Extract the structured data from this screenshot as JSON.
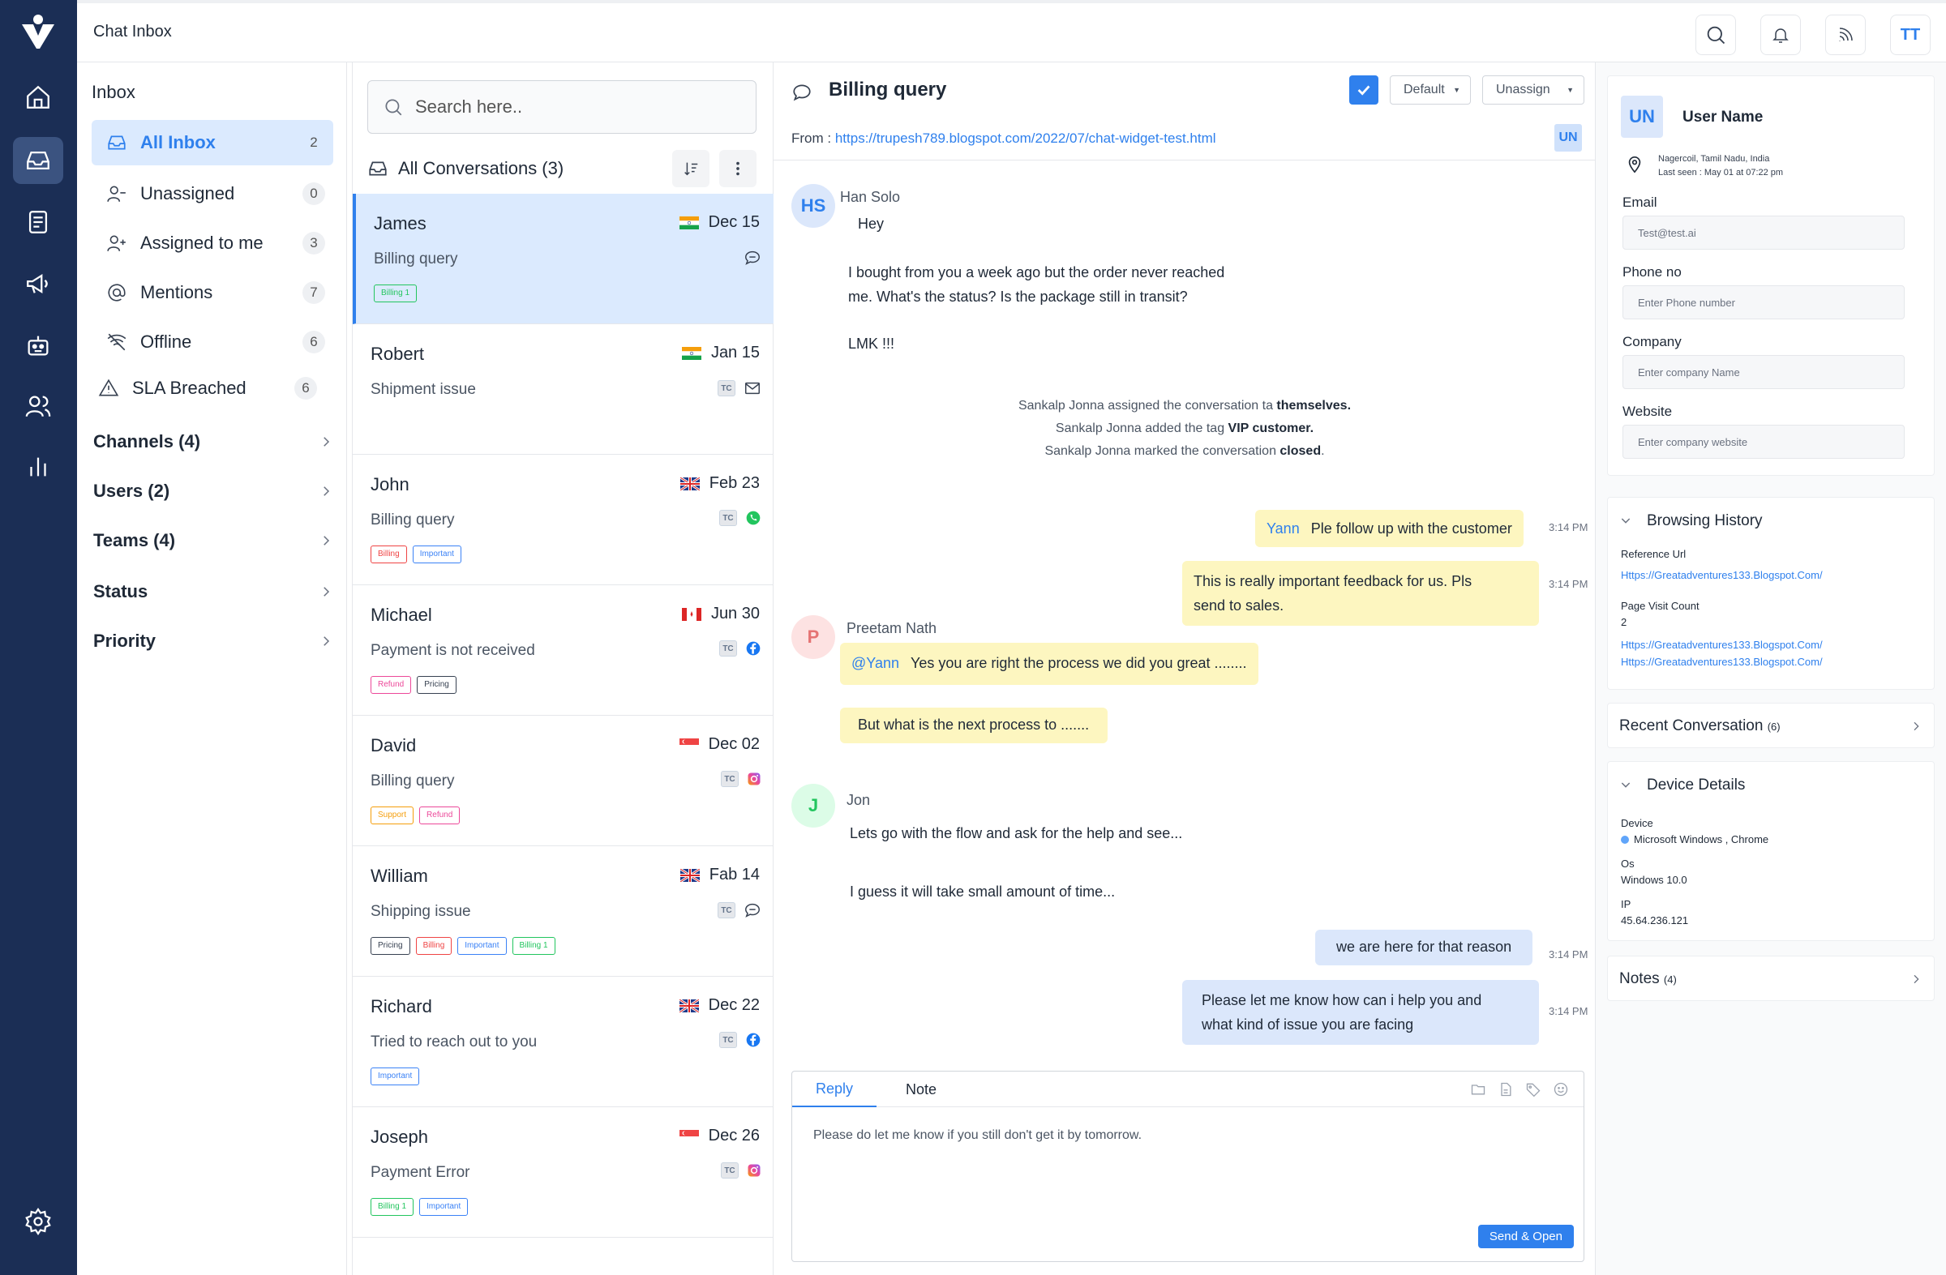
{
  "header": {
    "title": "Chat Inbox",
    "user_initials": "TT"
  },
  "rail": {
    "icons": [
      "logo-icon",
      "home-icon",
      "inbox-icon",
      "notes-icon",
      "megaphone-icon",
      "bot-icon",
      "users-icon",
      "analytics-icon",
      "settings-icon"
    ]
  },
  "inbox": {
    "heading": "Inbox",
    "items": [
      {
        "label": "All Inbox",
        "count": "2"
      },
      {
        "label": "Unassigned",
        "count": "0"
      },
      {
        "label": "Assigned to me",
        "count": "3"
      },
      {
        "label": "Mentions",
        "count": "7"
      },
      {
        "label": "Offline",
        "count": "6"
      },
      {
        "label": "SLA Breached",
        "count": "6"
      }
    ],
    "sections": [
      "Channels (4)",
      "Users (2)",
      "Teams (4)",
      "Status",
      "Priority"
    ]
  },
  "conversations": {
    "search_placeholder": "Search here..",
    "title": "All Conversations (3)",
    "items": [
      {
        "name": "James",
        "date": "Dec 15",
        "subject": "Billing query",
        "channel": "chat",
        "tags": [
          {
            "label": "Billing 1",
            "color": "#22c55e"
          }
        ]
      },
      {
        "name": "Robert",
        "date": "Jan 15",
        "subject": "Shipment issue",
        "channel": "email",
        "tc": "TC",
        "tags": []
      },
      {
        "name": "John",
        "date": "Feb 23",
        "subject": "Billing query",
        "channel": "whatsapp",
        "tc": "TC",
        "tags": [
          {
            "label": "Billing",
            "color": "#ef4444"
          },
          {
            "label": "Important",
            "color": "#3b82f6"
          }
        ]
      },
      {
        "name": "Michael",
        "date": "Jun 30",
        "subject": "Payment is not received",
        "channel": "facebook",
        "tc": "TC",
        "tags": [
          {
            "label": "Refund",
            "color": "#ec4899"
          },
          {
            "label": "Pricing",
            "color": "#374151"
          }
        ]
      },
      {
        "name": "David",
        "date": "Dec 02",
        "subject": "Billing query",
        "channel": "instagram",
        "tc": "TC",
        "tags": [
          {
            "label": "Support",
            "color": "#f59e0b"
          },
          {
            "label": "Refund",
            "color": "#ec4899"
          }
        ]
      },
      {
        "name": "William",
        "date": "Fab 14",
        "subject": "Shipping issue",
        "channel": "chat",
        "tc": "TC",
        "tags": [
          {
            "label": "Pricing",
            "color": "#374151"
          },
          {
            "label": "Billing",
            "color": "#ef4444"
          },
          {
            "label": "Important",
            "color": "#3b82f6"
          },
          {
            "label": "Billing 1",
            "color": "#22c55e"
          }
        ]
      },
      {
        "name": "Richard",
        "date": "Dec 22",
        "subject": "Tried to reach out to you",
        "channel": "facebook",
        "tc": "TC",
        "tags": [
          {
            "label": "Important",
            "color": "#3b82f6"
          }
        ]
      },
      {
        "name": "Joseph",
        "date": "Dec 26",
        "subject": "Payment Error",
        "channel": "instagram",
        "tc": "TC",
        "tags": [
          {
            "label": "Billing 1",
            "color": "#22c55e"
          },
          {
            "label": "Important",
            "color": "#3b82f6"
          }
        ]
      }
    ]
  },
  "chat": {
    "title": "Billing query",
    "dropdown_default": "Default",
    "dropdown_assign": "Unassign",
    "from_label": "From :",
    "from_url": "https://trupesh789.blogspot.com/2022/07/chat-widget-test.html",
    "user_badge": "UN",
    "messages": {
      "m1_initials": "HS",
      "m1_sender": "Han Solo",
      "m1_text1": "Hey",
      "m1_text2a": "I bought from you a week ago but the order never reached",
      "m1_text2b": "me. What's the status? Is the package still in transit?",
      "m1_text3": "LMK !!!",
      "sys1_a": "Sankalp Jonna assigned the conversation ta ",
      "sys1_b": "themselves.",
      "sys2_a": "Sankalp Jonna added the tag ",
      "sys2_b": "VIP customer.",
      "sys3_a": "Sankalp Jonna marked the conversation ",
      "sys3_b": "closed",
      "sys3_c": ".",
      "n1_name": "Yann",
      "n1_text": "Ple follow up with the customer",
      "n1_time": "3:14 PM",
      "n2_text_a": "This is really important feedback for us. Pls",
      "n2_text_b": "send to sales.",
      "n2_time": "3:14 PM",
      "m2_initial": "P",
      "m2_sender": "Preetam Nath",
      "m2_mention": "@Yann",
      "m2_text1": "Yes you are right the process we did you great ........",
      "m2_text2": "But what is the next process to .......",
      "m3_initial": "J",
      "m3_sender": "Jon",
      "m3_text1": "Lets go with the flow and ask for the help and see...",
      "m3_text2": "I guess it will take small amount of time...",
      "r1_text": "we are here for that reason",
      "r1_time": "3:14 PM",
      "r2_text_a": "Please let me know how can i help you and",
      "r2_text_b": "what kind of issue you are facing",
      "r2_time": "3:14 PM"
    },
    "reply": {
      "tab_reply": "Reply",
      "tab_note": "Note",
      "draft": "Please do let me know if you still don't get it by tomorrow.",
      "send_label": "Send & Open"
    }
  },
  "profile": {
    "initials": "UN",
    "name": "User Name",
    "location": "Nagercoil, Tamil Nadu, India",
    "last_seen": "Last seen : May 01 at 07:22 pm",
    "email_label": "Email",
    "email_value": "Test@test.ai",
    "phone_label": "Phone no",
    "phone_placeholder": "Enter Phone number",
    "company_label": "Company",
    "company_placeholder": "Enter company Name",
    "website_label": "Website",
    "website_placeholder": "Enter company website",
    "browsing": {
      "title": "Browsing History",
      "ref_label": "Reference Url",
      "ref_url": "Https://Greatadventures133.Blogspot.Com/",
      "count_label": "Page Visit Count",
      "count_value": "2",
      "url1": "Https://Greatadventures133.Blogspot.Com/",
      "url2": "Https://Greatadventures133.Blogspot.Com/"
    },
    "recent": {
      "title": "Recent Conversation",
      "count": "(6)"
    },
    "device": {
      "title": "Device Details",
      "device_label": "Device",
      "device_value": "Microsoft Windows , Chrome",
      "os_label": "Os",
      "os_value": "Windows 10.0",
      "ip_label": "IP",
      "ip_value": "45.64.236.121"
    },
    "notes": {
      "title": "Notes",
      "count": "(4)"
    }
  }
}
